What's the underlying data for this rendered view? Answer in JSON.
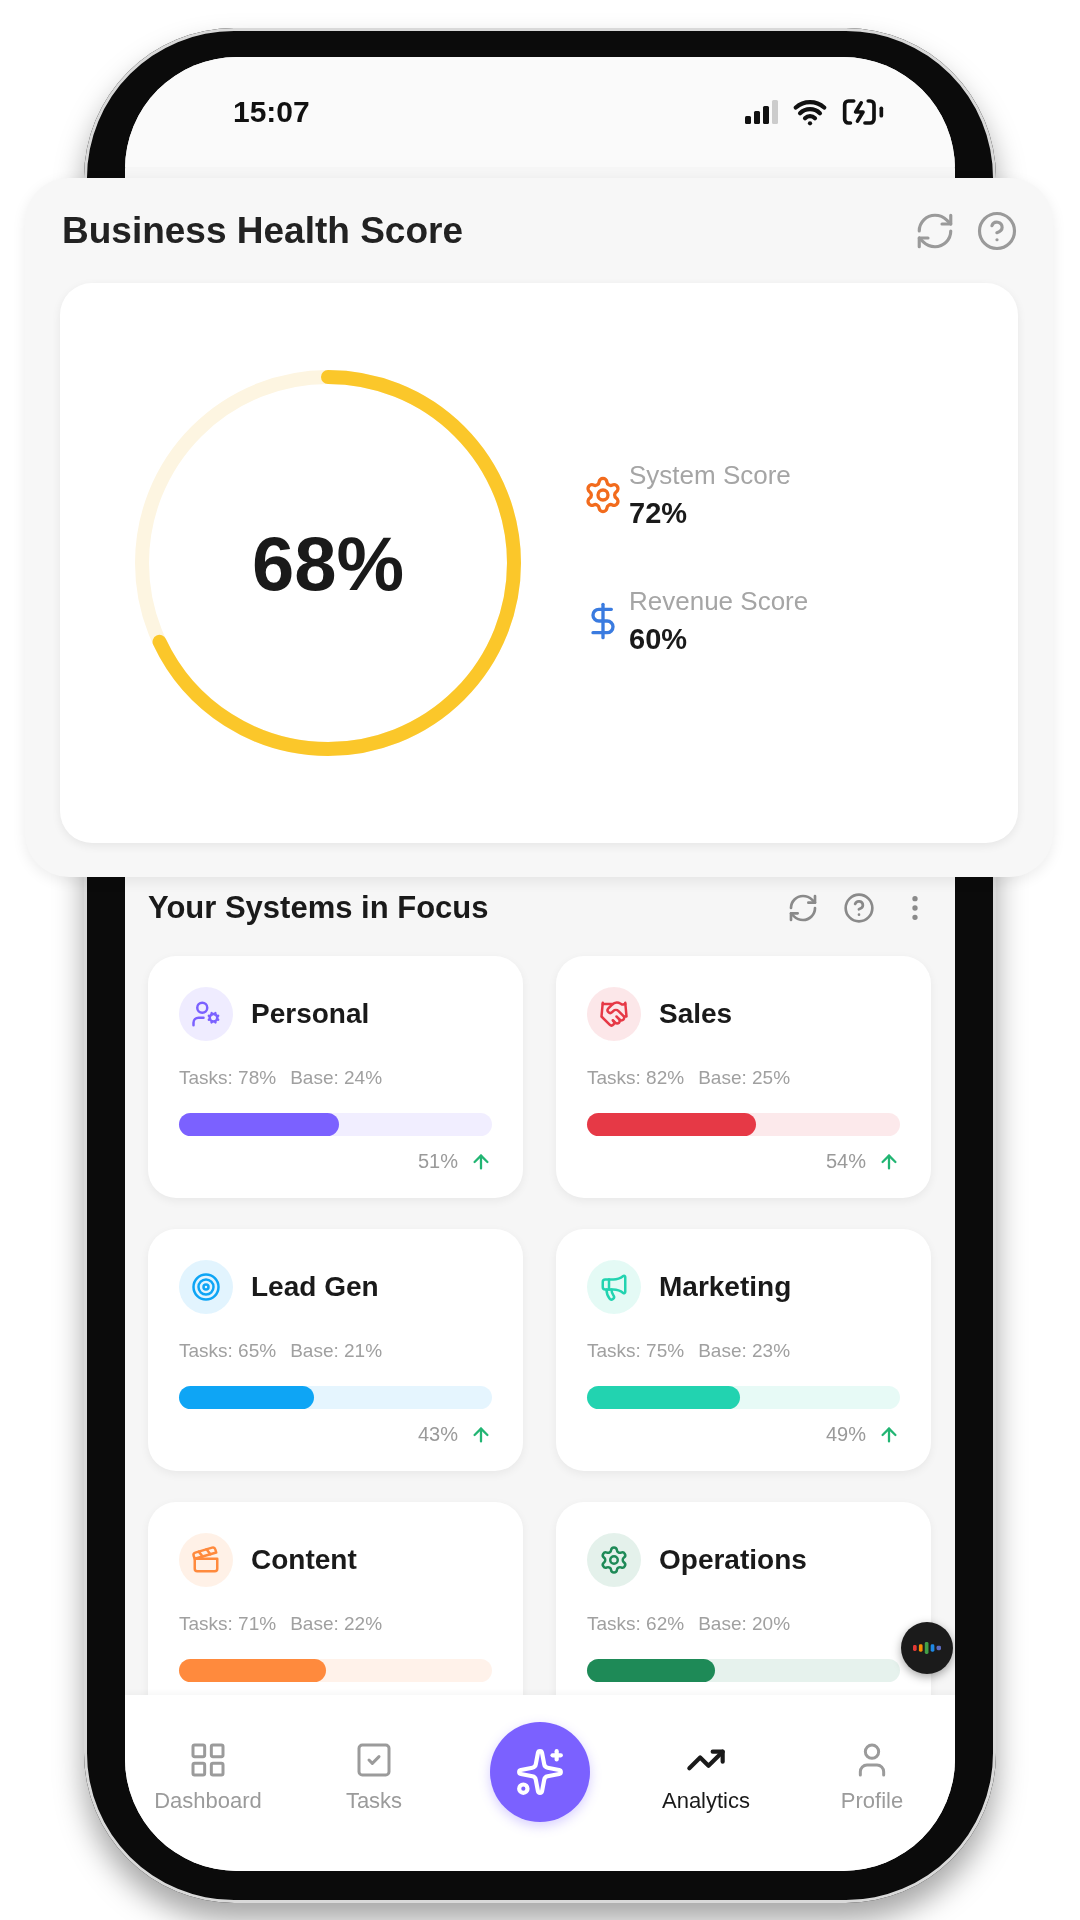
{
  "status_bar": {
    "time": "15:07"
  },
  "health": {
    "title": "Business Health Score",
    "score": "68%",
    "level": 0.68,
    "metrics": [
      {
        "label": "System Score",
        "value": "72%",
        "kind": "system"
      },
      {
        "label": "Revenue Score",
        "value": "60%",
        "kind": "revenue"
      }
    ]
  },
  "systems": {
    "title": "Your Systems in Focus",
    "cards": [
      {
        "name": "Personal",
        "tasks": "Tasks: 78%",
        "base": "Base: 24%",
        "level": 0.51,
        "reading": "51%",
        "color": "#7b61ff"
      },
      {
        "name": "Sales",
        "tasks": "Tasks: 82%",
        "base": "Base: 25%",
        "level": 0.54,
        "reading": "54%",
        "color": "#e63946"
      },
      {
        "name": "Lead Gen",
        "tasks": "Tasks: 65%",
        "base": "Base: 21%",
        "level": 0.43,
        "reading": "43%",
        "color": "#0ea5f5"
      },
      {
        "name": "Marketing",
        "tasks": "Tasks: 75%",
        "base": "Base: 23%",
        "level": 0.49,
        "reading": "49%",
        "color": "#22d3b0"
      },
      {
        "name": "Content",
        "tasks": "Tasks: 71%",
        "base": "Base: 22%",
        "level": 0.47,
        "color": "#ff8a3d"
      },
      {
        "name": "Operations",
        "tasks": "Tasks: 62%",
        "base": "Base: 20%",
        "level": 0.41,
        "color": "#1e8a57"
      }
    ]
  },
  "nav": [
    {
      "kind": "tab",
      "label": "Dashboard",
      "selected": false
    },
    {
      "kind": "tab",
      "label": "Tasks",
      "selected": false
    },
    {
      "kind": "action"
    },
    {
      "kind": "tab",
      "label": "Analytics",
      "selected": true
    },
    {
      "kind": "tab",
      "label": "Profile",
      "selected": false
    }
  ]
}
